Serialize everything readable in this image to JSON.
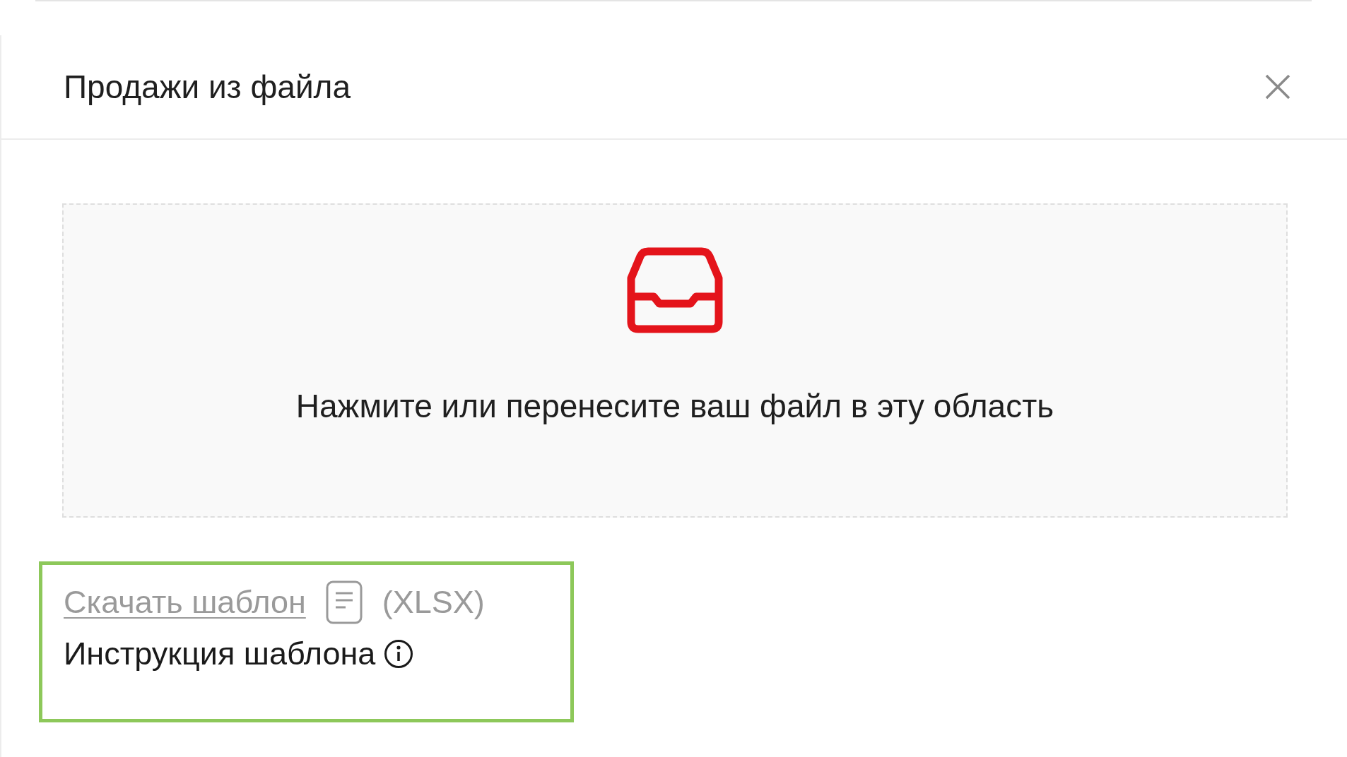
{
  "modal": {
    "title": "Продажи из файла"
  },
  "dropzone": {
    "text": "Нажмите или перенесите ваш файл в эту область"
  },
  "template": {
    "download_link": "Скачать шаблон",
    "format": "(XLSX)",
    "instruction": "Инструкция шаблона",
    "highlighted": true
  }
}
